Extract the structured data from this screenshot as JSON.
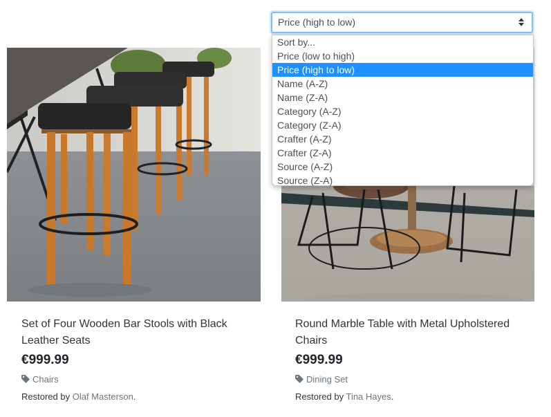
{
  "sort": {
    "selected_label": "Price (high to low)",
    "options": [
      "Sort by...",
      "Price (low to high)",
      "Price (high to low)",
      "Name (A-Z)",
      "Name (Z-A)",
      "Category (A-Z)",
      "Category (Z-A)",
      "Crafter (A-Z)",
      "Crafter (Z-A)",
      "Source (A-Z)",
      "Source (Z-A)"
    ],
    "highlight_color": "#1e90ff"
  },
  "products": [
    {
      "title_line1": "Set of Four Wooden Bar Stools with Black",
      "title_line2": "Leather Seats",
      "price": "€999.99",
      "category": "Chairs",
      "restored_prefix": "Restored by",
      "crafter": "Olaf Masterson",
      "suffix": "."
    },
    {
      "title_line1": "Round Marble Table with Metal Upholstered",
      "title_line2": "Chairs",
      "price": "€999.99",
      "category": "Dining Set",
      "restored_prefix": "Restored by",
      "crafter": "Tina Hayes",
      "suffix": "."
    }
  ],
  "icons": {
    "sort_arrows": "sort-updown-icon",
    "category": "tag-icon"
  }
}
